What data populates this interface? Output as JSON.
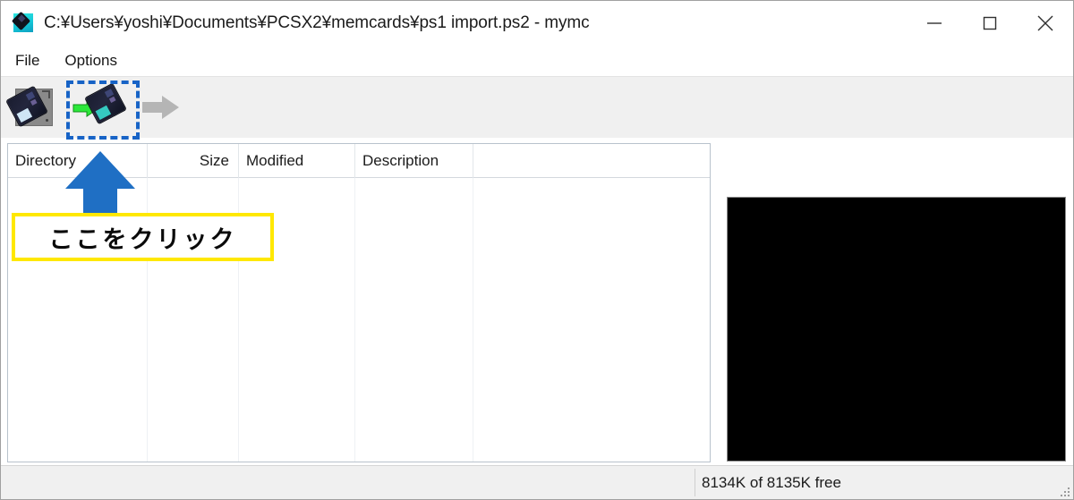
{
  "window": {
    "title": "C:¥Users¥yoshi¥Documents¥PCSX2¥memcards¥ps1 import.ps2 - mymc",
    "app_icon": "memcard-icon",
    "controls": {
      "minimize": "minimize-icon",
      "maximize": "maximize-icon",
      "close": "close-icon"
    }
  },
  "menu": {
    "items": [
      {
        "label": "File"
      },
      {
        "label": "Options"
      }
    ]
  },
  "toolbar": {
    "buttons": [
      {
        "name": "open-memcard",
        "icon": "open-memcard-icon",
        "enabled": true,
        "highlighted": false
      },
      {
        "name": "import-save",
        "icon": "import-save-icon",
        "enabled": true,
        "highlighted": true
      },
      {
        "name": "export-save",
        "icon": "export-save-icon",
        "enabled": false,
        "highlighted": false
      }
    ]
  },
  "file_list": {
    "columns": [
      {
        "label": "Directory"
      },
      {
        "label": "Size"
      },
      {
        "label": "Modified"
      },
      {
        "label": "Description"
      },
      {
        "label": ""
      }
    ],
    "rows": []
  },
  "preview": {
    "name": "save-icon-preview",
    "background": "#000000"
  },
  "status_bar": {
    "text": "8134K of 8135K free",
    "grip": "resize-grip-icon"
  },
  "annotation": {
    "text": "ここをクリック",
    "box_border_color": "#ffe800",
    "arrow_color": "#1f6fc4",
    "highlight_color": "#1763c6"
  }
}
